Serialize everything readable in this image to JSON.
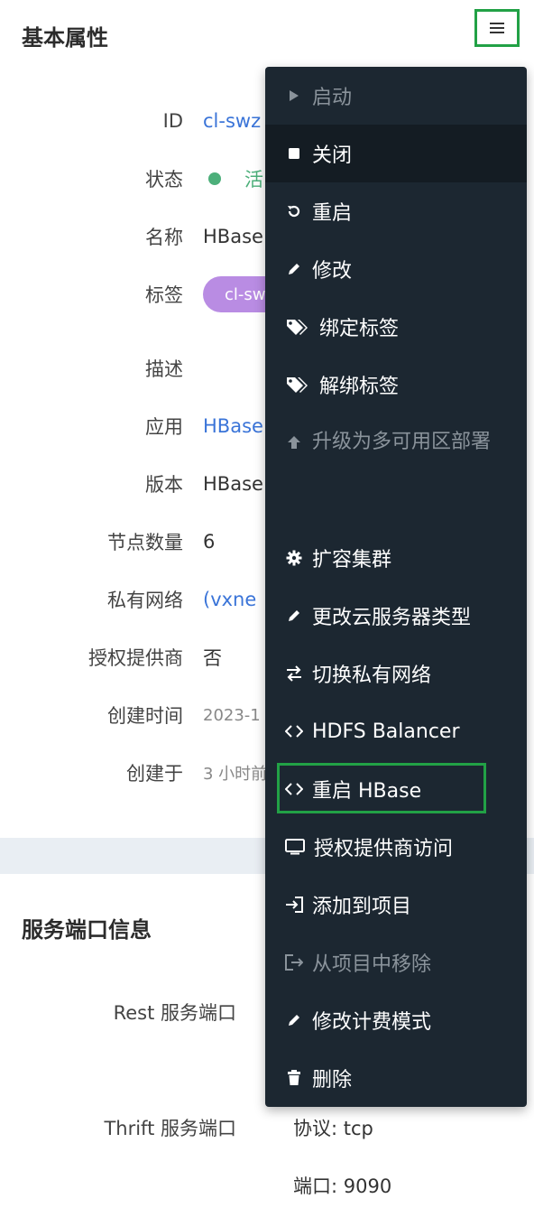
{
  "basic": {
    "title": "基本属性",
    "rows": [
      {
        "label": "ID",
        "value": "cl-swz"
      },
      {
        "label": "状态",
        "value": "活"
      },
      {
        "label": "名称",
        "value": "HBase"
      },
      {
        "label": "标签",
        "value": "cl-sw"
      },
      {
        "label": "描述",
        "value": ""
      },
      {
        "label": "应用",
        "value": "HBase"
      },
      {
        "label": "版本",
        "value": "HBase"
      },
      {
        "label": "节点数量",
        "value": "6"
      },
      {
        "label": "私有网络",
        "value": "(vxne"
      },
      {
        "label": "授权提供商",
        "value": "否"
      },
      {
        "label": "创建时间",
        "value": "2023-1"
      },
      {
        "label": "创建于",
        "value": "3 小时前"
      }
    ]
  },
  "ports": {
    "title": "服务端口信息",
    "rest_label": "Rest 服务端口",
    "thrift_label": "Thrift 服务端口",
    "thrift_protocol": "协议: tcp",
    "thrift_port": "端口: 9090"
  },
  "menu": {
    "items": [
      {
        "label": "启动",
        "icon": "play-icon",
        "disabled": true
      },
      {
        "label": "关闭",
        "icon": "stop-icon",
        "active": true
      },
      {
        "label": "重启",
        "icon": "restart-icon"
      },
      {
        "label": "修改",
        "icon": "pencil-icon"
      },
      {
        "label": "绑定标签",
        "icon": "tags-icon"
      },
      {
        "label": "解绑标签",
        "icon": "tags-icon"
      },
      {
        "label": "升级为多可用区部署",
        "icon": "arrow-up-icon",
        "disabled": true
      },
      {
        "label": "扩容集群",
        "icon": "gear-icon"
      },
      {
        "label": "更改云服务器类型",
        "icon": "pencil-icon"
      },
      {
        "label": "切换私有网络",
        "icon": "switch-icon"
      },
      {
        "label": "HDFS Balancer",
        "icon": "code-icon"
      },
      {
        "label": "重启 HBase",
        "icon": "code-icon"
      },
      {
        "label": "授权提供商访问",
        "icon": "monitor-icon"
      },
      {
        "label": "添加到项目",
        "icon": "login-icon"
      },
      {
        "label": "从项目中移除",
        "icon": "logout-icon",
        "disabled": true
      },
      {
        "label": "修改计费模式",
        "icon": "pencil-icon"
      },
      {
        "label": "删除",
        "icon": "trash-icon"
      }
    ]
  },
  "colors": {
    "accent_green": "#22a146",
    "link_blue": "#3a74d8",
    "menu_bg": "#1c2731",
    "tag_purple": "#b98ce3",
    "status_green": "#4caf7a"
  }
}
